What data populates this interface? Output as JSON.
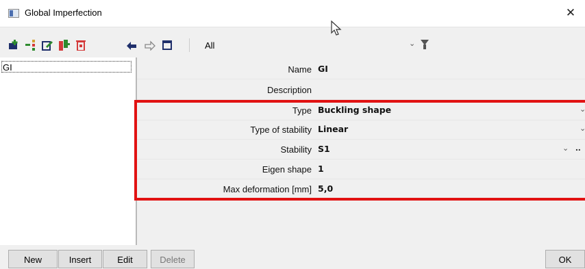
{
  "window": {
    "title": "Global Imperfection",
    "close_glyph": "✕"
  },
  "toolbar": {
    "icons": [
      "new-icon",
      "insert-icon",
      "edit-icon",
      "copy-icon",
      "delete-icon",
      "undo-icon",
      "redo-icon",
      "window-icon"
    ],
    "filter_value": "All",
    "filter_chevron": "⌄"
  },
  "list": {
    "items": [
      {
        "label": "GI"
      }
    ]
  },
  "properties": {
    "name": {
      "label": "Name",
      "value": "GI"
    },
    "description": {
      "label": "Description",
      "value": ""
    },
    "type": {
      "label": "Type",
      "value": "Buckling shape"
    },
    "type_of_stability": {
      "label": "Type of stability",
      "value": "Linear"
    },
    "stability": {
      "label": "Stability",
      "value": "S1"
    },
    "eigen_shape": {
      "label": "Eigen shape",
      "value": "1"
    },
    "max_deformation": {
      "label": "Max deformation [mm]",
      "value": "5,0"
    },
    "dropdown_glyph": "⌄",
    "ellipsis": ".."
  },
  "buttons": {
    "new": "New",
    "insert": "Insert",
    "edit": "Edit",
    "delete": "Delete",
    "ok": "OK"
  },
  "colors": {
    "highlight": "#e11212",
    "icon_green": "#2e8b2e",
    "icon_red": "#d43a3a",
    "icon_navy": "#1f2f6b"
  }
}
